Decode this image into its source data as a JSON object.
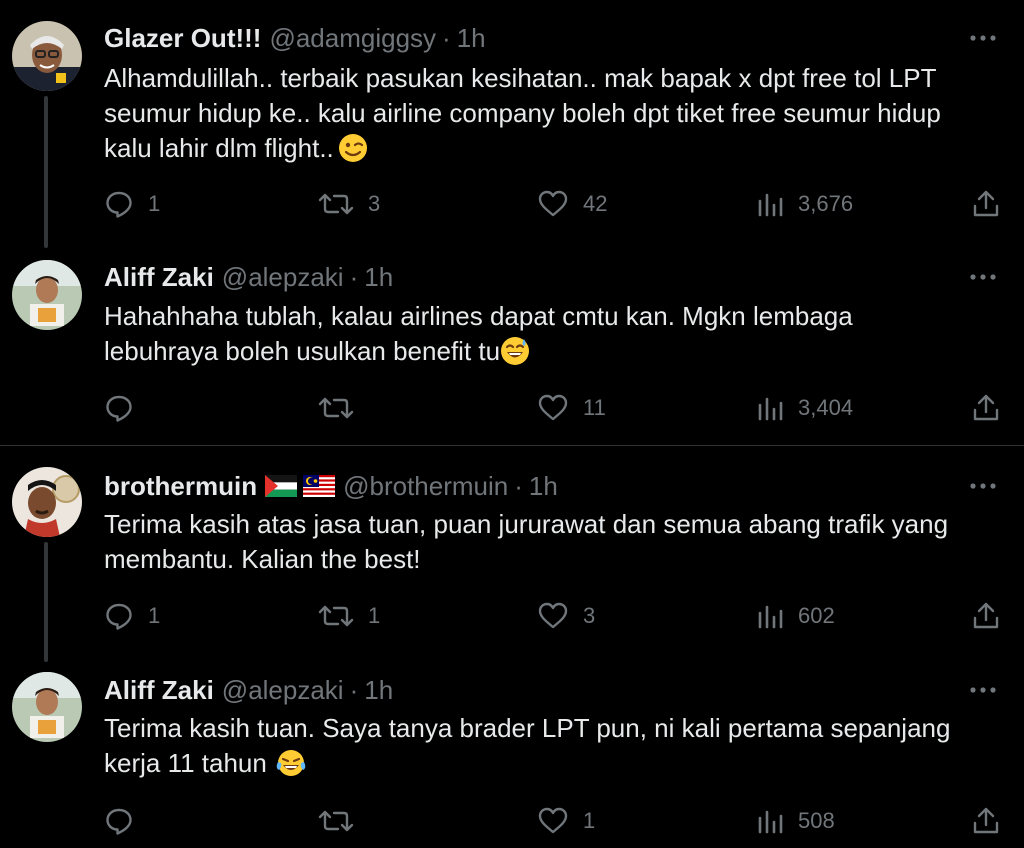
{
  "tweets": [
    {
      "name": "Glazer Out!!!",
      "handle": "@adamgiggsy",
      "dot": "·",
      "time": "1h",
      "lines": [
        "Alhamdulillah.. terbaik pasukan kesihatan.. mak bapak x dpt free tol LPT",
        "seumur hidup ke.. kalu airline company boleh dpt tiket free seumur hidup",
        "kalu lahir dlm flight.."
      ],
      "emoji": "winking-face",
      "replies": "1",
      "retweets": "3",
      "likes": "42",
      "views": "3,676"
    },
    {
      "name": "Aliff Zaki",
      "handle": "@alepzaki",
      "dot": "·",
      "time": "1h",
      "lines": [
        "Hahahhaha tublah, kalau airlines dapat cmtu kan. Mgkn lembaga",
        "lebuhraya boleh usulkan benefit tu"
      ],
      "emoji": "grinning-face-with-sweat",
      "replies": "",
      "retweets": "",
      "likes": "11",
      "views": "3,404"
    },
    {
      "name": "brothermuin",
      "flags": [
        "palestine-flag",
        "malaysia-flag"
      ],
      "handle": "@brothermuin",
      "dot": "·",
      "time": "1h",
      "lines": [
        "Terima kasih atas jasa tuan, puan jururawat dan semua abang trafik yang",
        "membantu. Kalian the best!"
      ],
      "replies": "1",
      "retweets": "1",
      "likes": "3",
      "views": "602"
    },
    {
      "name": "Aliff Zaki",
      "handle": "@alepzaki",
      "dot": "·",
      "time": "1h",
      "lines": [
        "Terima kasih tuan. Saya tanya brader LPT pun, ni kali pertama sepanjang",
        "kerja 11 tahun"
      ],
      "emoji": "face-with-tears-of-joy",
      "replies": "",
      "retweets": "",
      "likes": "1",
      "views": "508"
    }
  ],
  "colors": {
    "background": "#000000",
    "text": "#e7e9ea",
    "muted": "#71767b",
    "divider": "#2f3336",
    "thread_line": "#333639"
  }
}
